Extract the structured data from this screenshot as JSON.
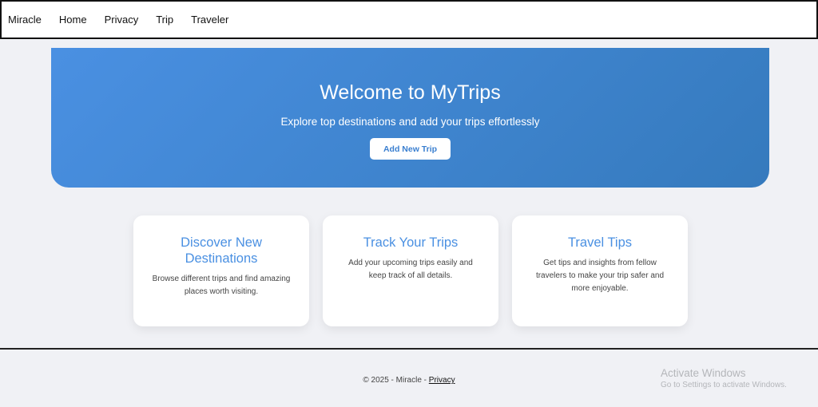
{
  "nav": {
    "brand": "Miracle",
    "items": [
      "Home",
      "Privacy",
      "Trip",
      "Traveler"
    ]
  },
  "hero": {
    "title": "Welcome to MyTrips",
    "subtitle": "Explore top destinations and add your trips effortlessly",
    "button": "Add New Trip"
  },
  "cards": [
    {
      "title": "Discover New Destinations",
      "text": "Browse different trips and find amazing places worth visiting."
    },
    {
      "title": "Track Your Trips",
      "text": "Add your upcoming trips easily and keep track of all details."
    },
    {
      "title": "Travel Tips",
      "text": "Get tips and insights from fellow travelers to make your trip safer and more enjoyable."
    }
  ],
  "footer": {
    "text": "© 2025 - Miracle - ",
    "link": "Privacy"
  },
  "watermark": {
    "title": "Activate Windows",
    "subtitle": "Go to Settings to activate Windows."
  }
}
